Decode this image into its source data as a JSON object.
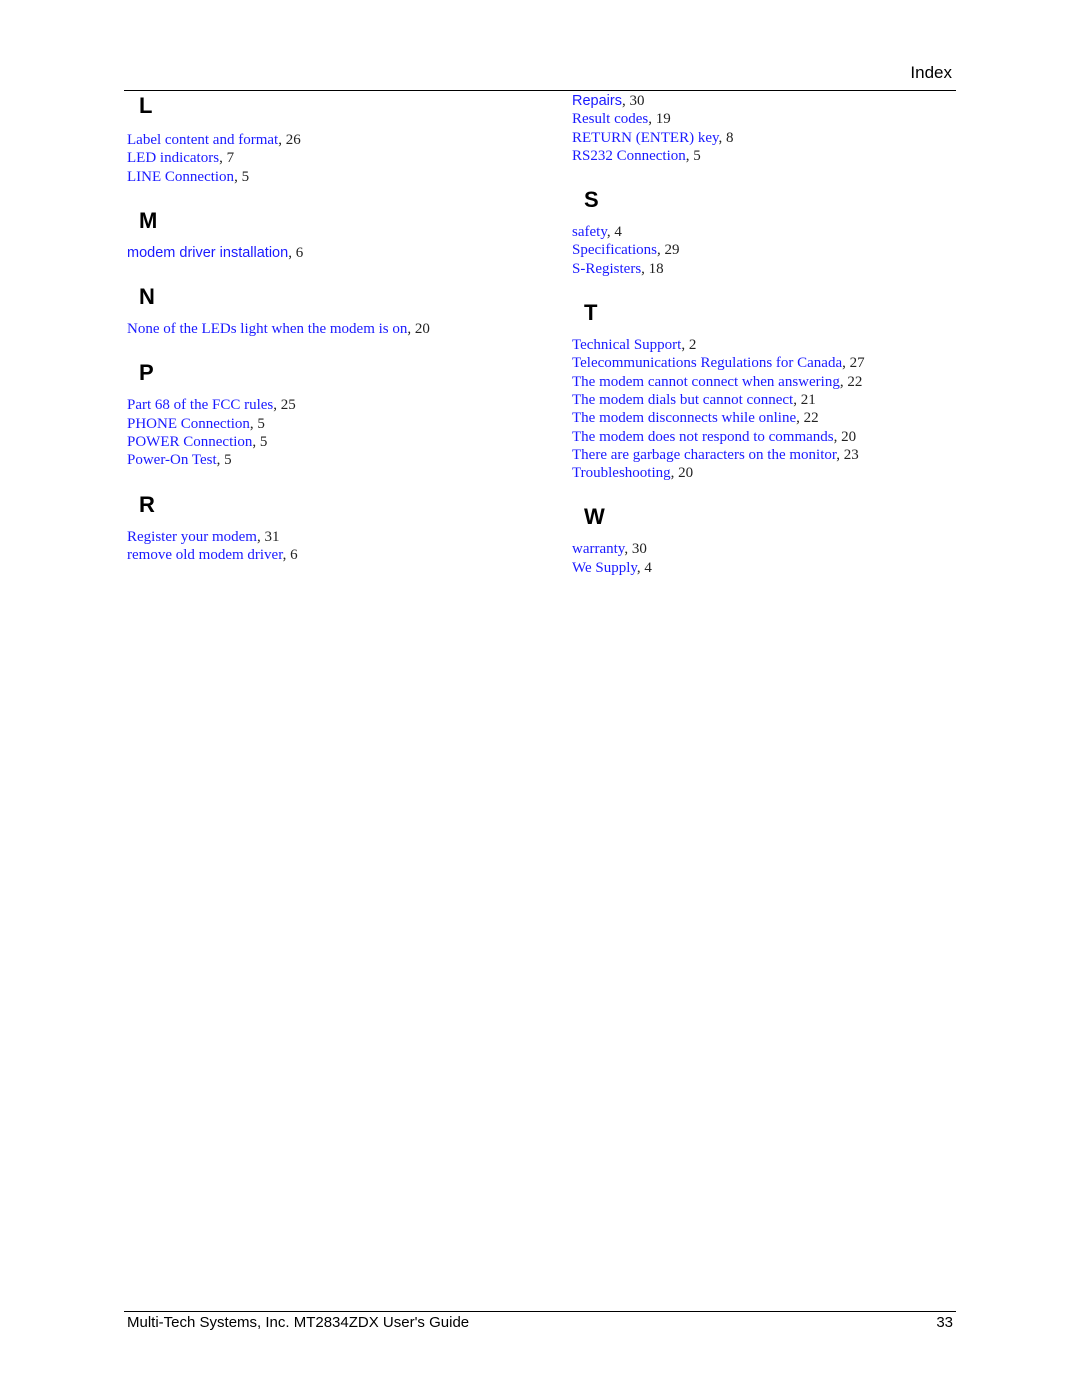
{
  "header": {
    "title": "Index"
  },
  "left_column": [
    {
      "letter": "L",
      "entries": [
        {
          "term": "Label content and format",
          "page": "26"
        },
        {
          "term": "LED indicators",
          "page": "7"
        },
        {
          "term": "LINE Connection",
          "page": "5"
        }
      ]
    },
    {
      "letter": "M",
      "entries": [
        {
          "term": "modem driver installation",
          "page": "6"
        }
      ]
    },
    {
      "letter": "N",
      "entries": [
        {
          "term": "None of the LEDs light when the modem is on",
          "page": "20"
        }
      ]
    },
    {
      "letter": "P",
      "entries": [
        {
          "term": "Part 68 of the FCC rules",
          "page": "25"
        },
        {
          "term": "PHONE Connection",
          "page": "5"
        },
        {
          "term": "POWER Connection",
          "page": "5"
        },
        {
          "term": "Power-On Test",
          "page": "5"
        }
      ]
    },
    {
      "letter": "R",
      "entries": [
        {
          "term": "Register your modem",
          "page": "31"
        },
        {
          "term": "remove old modem driver",
          "page": "6"
        }
      ]
    }
  ],
  "right_column": [
    {
      "letter": "",
      "entries": [
        {
          "term": "Repairs",
          "page": "30"
        },
        {
          "term": "Result codes",
          "page": "19"
        },
        {
          "term": "RETURN (ENTER) key",
          "page": "8"
        },
        {
          "term": "RS232 Connection",
          "page": "5"
        }
      ]
    },
    {
      "letter": "S",
      "entries": [
        {
          "term": "safety",
          "page": "4"
        },
        {
          "term": "Specifications",
          "page": "29"
        },
        {
          "term": "S-Registers",
          "page": "18"
        }
      ]
    },
    {
      "letter": "T",
      "entries": [
        {
          "term": "Technical Support",
          "page": "2"
        },
        {
          "term": "Telecommunications Regulations for Canada",
          "page": "27"
        },
        {
          "term": "The modem cannot connect when answering",
          "page": "22"
        },
        {
          "term": "The modem dials but cannot connect",
          "page": "21"
        },
        {
          "term": "The modem disconnects while online",
          "page": "22"
        },
        {
          "term": "The modem does not respond to commands",
          "page": "20"
        },
        {
          "term": "There are garbage characters on the monitor",
          "page": "23"
        },
        {
          "term": "Troubleshooting",
          "page": "20"
        }
      ]
    },
    {
      "letter": "W",
      "entries": [
        {
          "term": "warranty",
          "page": "30"
        },
        {
          "term": "We Supply",
          "page": "4"
        }
      ]
    }
  ],
  "footer": {
    "text": "Multi-Tech Systems, Inc. MT2834ZDX User's Guide",
    "page_number": "33"
  },
  "colors": {
    "link": "#1a1aff",
    "text": "#222222"
  }
}
